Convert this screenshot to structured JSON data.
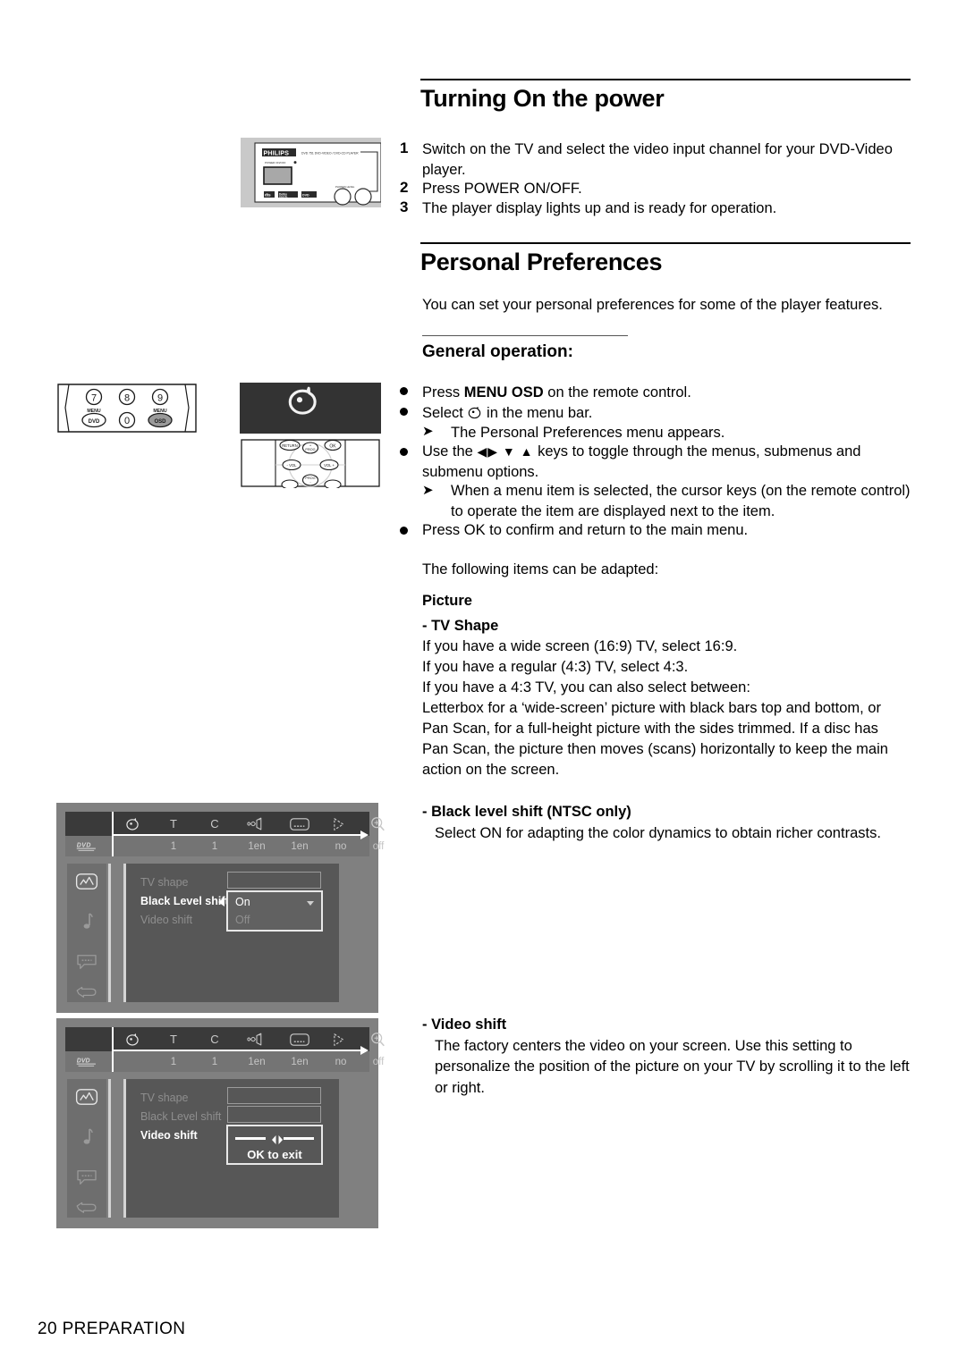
{
  "page": {
    "footer": "20 PREPARATION"
  },
  "section1": {
    "title": "Turning On the power",
    "steps": [
      {
        "num": "1",
        "text": "Switch on the TV and select the video input channel for your DVD-Video player."
      },
      {
        "num": "2",
        "text": "Press POWER ON/OFF."
      },
      {
        "num": "3",
        "text": "The player display lights up and is ready for operation."
      }
    ]
  },
  "section2": {
    "title": "Personal Preferences",
    "intro": "You can set your personal preferences for some of the player features.",
    "subtitle": "General operation:",
    "bullets": [
      {
        "kind": "dot",
        "pre": "Press ",
        "strong": "MENU OSD",
        "post": " on the remote control."
      },
      {
        "kind": "dot",
        "pre": "Select ",
        "strong": "",
        "post": " in the menu bar.",
        "icon": "head-icon"
      },
      {
        "kind": "arrow",
        "text": "The Personal Preferences menu appears."
      },
      {
        "kind": "dot",
        "pre": "Use the ",
        "strong": "",
        "post": " keys to toggle through the menus, submenus and submenu options.",
        "keys": "◀▶ ▼ ▲"
      },
      {
        "kind": "arrow",
        "text": "When a menu item is selected, the cursor keys (on the remote control) to operate the item are displayed next to the item."
      },
      {
        "kind": "dot",
        "pre": "Press OK to confirm and return to the main menu.",
        "strong": "",
        "post": ""
      }
    ],
    "following": "The following items can be adapted:",
    "items": [
      {
        "heading": "Picture",
        "sub_heading": "-  TV Shape",
        "lines": [
          "If you have a wide screen (16:9) TV, select 16:9.",
          "If you have a regular (4:3) TV, select 4:3.",
          "If you have a 4:3 TV, you can also select between:",
          "Letterbox for a ‘wide-screen’ picture with black bars top and bottom, or",
          "Pan Scan, for a full-height picture with the sides trimmed. If a disc has",
          "Pan Scan, the picture then moves (scans) horizontally to keep the main",
          "action on the screen."
        ]
      },
      {
        "heading": "- Black level shift (NTSC only)",
        "lines": [
          "Select ON for adapting the color dynamics to obtain richer contrasts."
        ]
      },
      {
        "heading": "- Video shift",
        "lines": [
          "The factory centers the video on your screen. Use this setting to personalize the position of the picture on your TV by scrolling it to the left or right."
        ]
      }
    ]
  },
  "osd": {
    "menubar": {
      "icons": [
        "head-icon",
        "title-T",
        "chapter-C",
        "audio-icon",
        "subtitle-icon",
        "angle-icon",
        "zoom-icon"
      ],
      "labels": [
        "T",
        "C",
        "",
        "",
        "",
        ""
      ],
      "disc_label": "DVD",
      "values": [
        "1",
        "1",
        "1en",
        "1en",
        "no",
        "off"
      ]
    },
    "sidebar_icons": [
      "picture-icon",
      "sound-icon",
      "language-icon",
      "features-icon"
    ],
    "screen1": {
      "rows": [
        {
          "label": "TV shape",
          "state": "dim"
        },
        {
          "label": "Black Level shift",
          "state": "active"
        },
        {
          "label": "Video shift",
          "state": "dim"
        }
      ],
      "dropdown": {
        "selected": "On",
        "other": "Off"
      }
    },
    "screen2": {
      "rows": [
        {
          "label": "TV shape",
          "state": "dim"
        },
        {
          "label": "Black Level shift",
          "state": "dim"
        },
        {
          "label": "Video shift",
          "state": "active"
        }
      ],
      "slider": {
        "hint": "OK to exit"
      }
    }
  },
  "remote": {
    "keys_top": [
      "7",
      "8",
      "9"
    ],
    "keys_bottom": [
      {
        "over": "MENU",
        "label": "DVD"
      },
      {
        "over": "",
        "label": "0"
      },
      {
        "over": "MENU",
        "label": "OSD"
      }
    ],
    "cursor_pad": [
      "RETURN",
      "OK",
      "PROG +",
      "VOL -",
      "VOL +",
      "PROG -"
    ]
  },
  "device": {
    "brand": "PHILIPS",
    "model_line": "DVD 751  DVD-VIDEO / DVD PLAYER",
    "power_label": "POWER ON/OFF",
    "badges": [
      "dts",
      "Dolby Digital",
      "DVD VIDEO"
    ],
    "knob_label": "PHONES  LEVEL"
  },
  "colors": {
    "osd_bg": "#808080",
    "osd_bar_top": "#3a3a3a",
    "osd_bar_bottom": "#747474",
    "osd_panel": "#575757",
    "osd_sidebar": "#6e6e6e",
    "highlight": "#ffffff",
    "dim_text": "#8e8e8e",
    "icon_box_bg": "#333333"
  }
}
